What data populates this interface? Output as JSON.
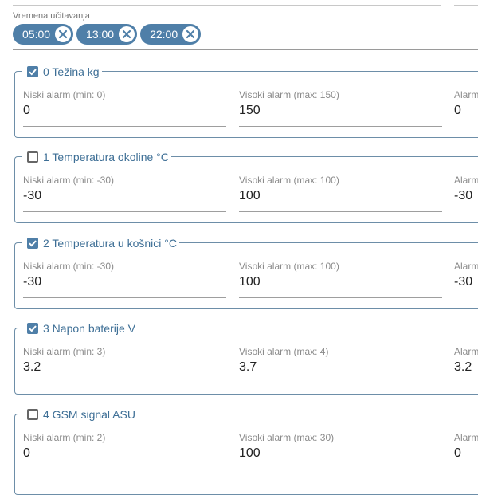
{
  "reading_times": {
    "label": "Vremena učitavanja",
    "chips": [
      "05:00",
      "13:00",
      "22:00"
    ]
  },
  "sensors": [
    {
      "title": "0 Težina kg",
      "checked": true,
      "low_label": "Niski alarm (min: 0)",
      "low_value": "0",
      "high_label": "Visoki alarm (max: 150)",
      "high_value": "150",
      "third_label": "Alarm",
      "third_value": "0"
    },
    {
      "title": "1 Temperatura okoline °C",
      "checked": false,
      "low_label": "Niski alarm (min: -30)",
      "low_value": "-30",
      "high_label": "Visoki alarm (max: 100)",
      "high_value": "100",
      "third_label": "Alarm",
      "third_value": "-30"
    },
    {
      "title": "2 Temperatura u košnici °C",
      "checked": true,
      "low_label": "Niski alarm (min: -30)",
      "low_value": "-30",
      "high_label": "Visoki alarm (max: 100)",
      "high_value": "100",
      "third_label": "Alarm",
      "third_value": "-30"
    },
    {
      "title": "3 Napon baterije V",
      "checked": true,
      "low_label": "Niski alarm (min: 3)",
      "low_value": "3.2",
      "high_label": "Visoki alarm (max: 4)",
      "high_value": "3.7",
      "third_label": "Alarm",
      "third_value": "3.2"
    },
    {
      "title": "4 GSM signal ASU",
      "checked": false,
      "low_label": "Niski alarm (min: 2)",
      "low_value": "0",
      "high_label": "Visoki alarm (max: 30)",
      "high_value": "100",
      "third_label": "Alarm",
      "third_value": "0"
    }
  ],
  "colors": {
    "accent": "#4f7fa8",
    "legend_text": "#3e6f96"
  },
  "icons": {
    "chip_remove": "close-circle-icon",
    "checkbox_on": "check-icon"
  }
}
